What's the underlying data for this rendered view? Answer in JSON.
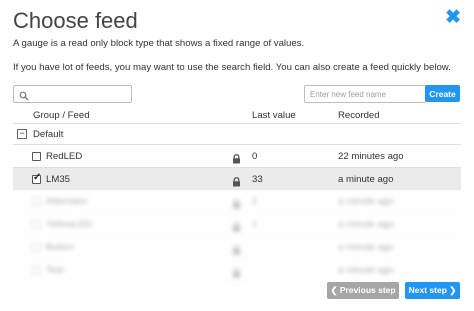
{
  "dialog": {
    "title": "Choose feed",
    "close_glyph": "✖",
    "description": "A gauge is a read only block type that shows a fixed range of values.",
    "hint": "If you have lot of feeds, you may want to use the search field. You can also create a feed quickly below.",
    "accent_color": "#2196f3"
  },
  "search": {
    "placeholder": "",
    "value": "",
    "icon": "search-icon"
  },
  "new_feed": {
    "placeholder": "Enter new feed name",
    "create_label": "Create"
  },
  "table": {
    "headers": {
      "group_feed": "Group / Feed",
      "last_value": "Last value",
      "recorded": "Recorded"
    },
    "group": {
      "toggle": "−",
      "name": "Default"
    },
    "feeds": [
      {
        "name": "RedLED",
        "checked": false,
        "locked": true,
        "last_value": "0",
        "recorded": "22 minutes ago"
      },
      {
        "name": "LM35",
        "checked": true,
        "locked": true,
        "last_value": "33",
        "recorded": "a minute ago"
      }
    ],
    "blurred_rows": [
      {
        "name": "Alternator",
        "value": "1",
        "recorded": "a minute ago"
      },
      {
        "name": "YellowLED",
        "value": "1",
        "recorded": "a minute ago"
      },
      {
        "name": "Button",
        "value": "",
        "recorded": "a minute ago"
      },
      {
        "name": "Test",
        "value": "",
        "recorded": "a minute ago"
      }
    ]
  },
  "footer": {
    "prev_label": "❮ Previous step",
    "next_label": "Next step ❯"
  }
}
